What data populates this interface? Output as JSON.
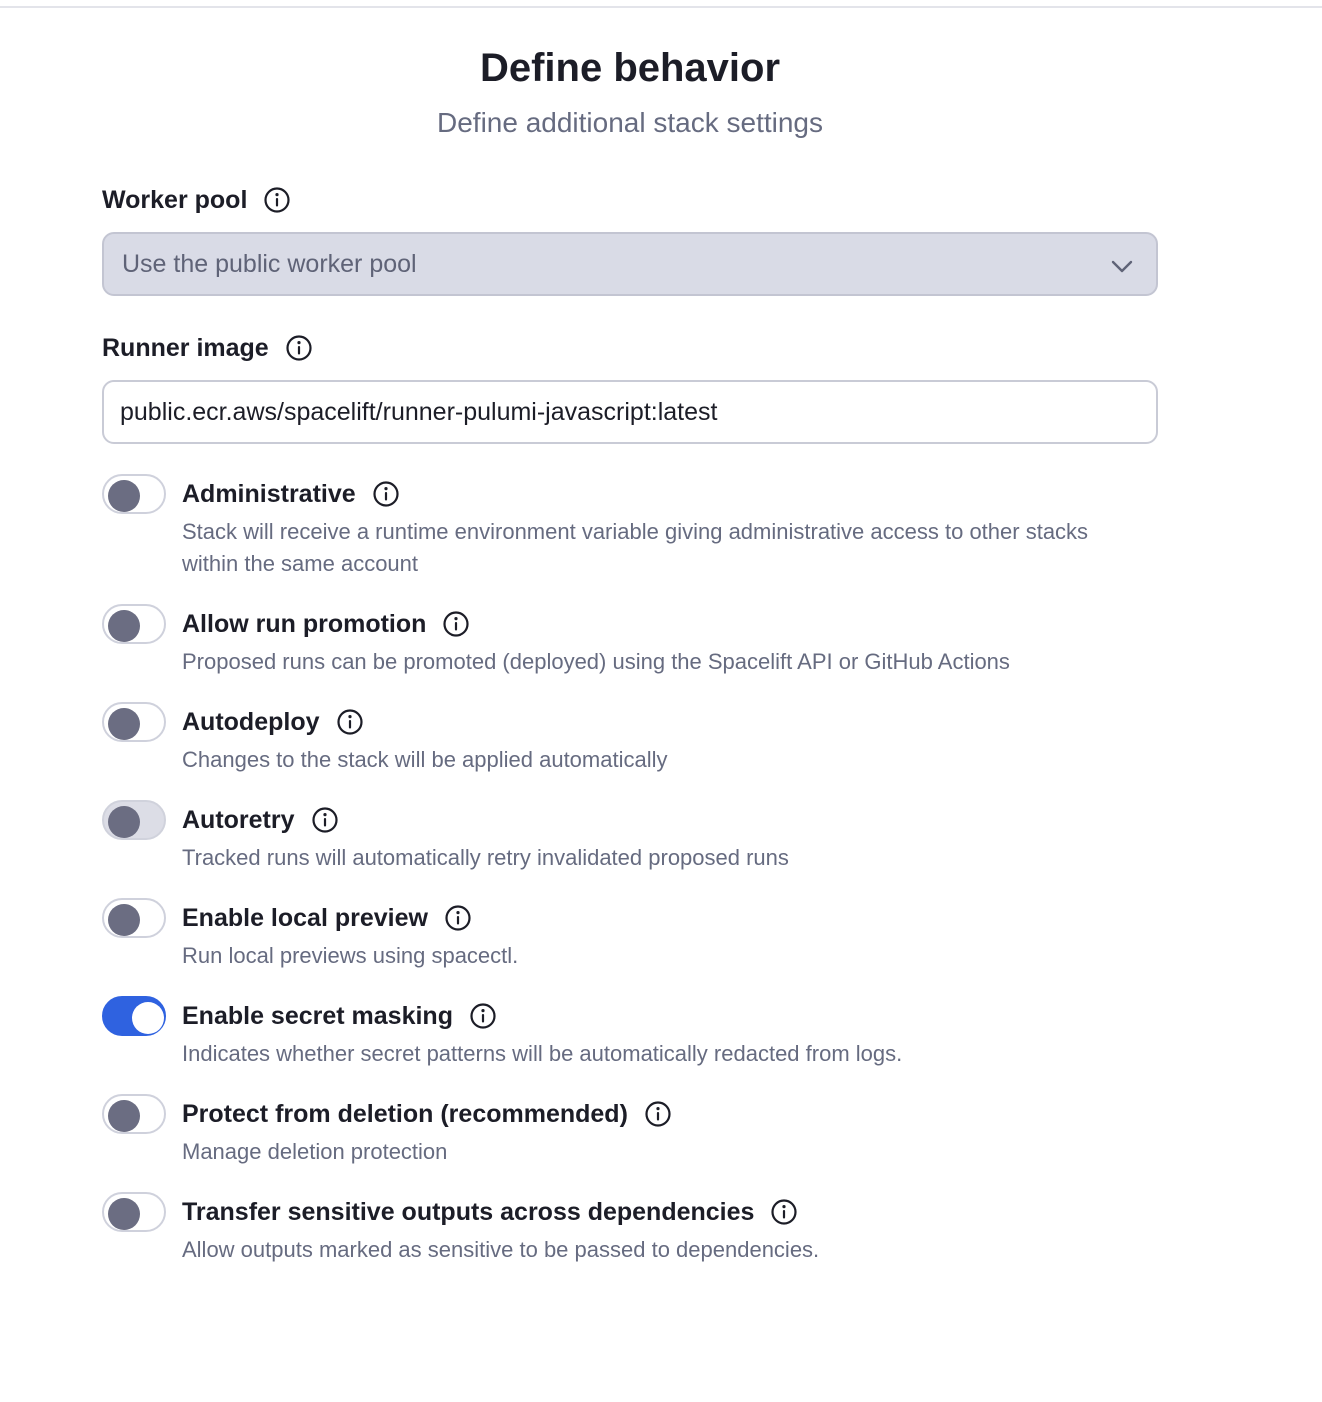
{
  "header": {
    "title": "Define behavior",
    "subtitle": "Define additional stack settings"
  },
  "worker_pool": {
    "label": "Worker pool",
    "value": "Use the public worker pool",
    "disabled": true
  },
  "runner_image": {
    "label": "Runner image",
    "value": "public.ecr.aws/spacelift/runner-pulumi-javascript:latest"
  },
  "toggles": [
    {
      "title": "Administrative",
      "description": "Stack will receive a runtime environment variable giving administrative access to other stacks within the same account",
      "on": false
    },
    {
      "title": "Allow run promotion",
      "description": "Proposed runs can be promoted (deployed) using the Spacelift API or GitHub Actions",
      "on": false
    },
    {
      "title": "Autodeploy",
      "description": "Changes to the stack will be applied automatically",
      "on": false
    },
    {
      "title": "Autoretry",
      "description": "Tracked runs will automatically retry invalidated proposed runs",
      "on": false,
      "disabled": true
    },
    {
      "title": "Enable local preview",
      "description": "Run local previews using spacectl.",
      "on": false
    },
    {
      "title": "Enable secret masking",
      "description": "Indicates whether secret patterns will be automatically redacted from logs.",
      "on": true
    },
    {
      "title": "Protect from deletion (recommended)",
      "description": "Manage deletion protection",
      "on": false
    },
    {
      "title": "Transfer sensitive outputs across dependencies",
      "description": "Allow outputs marked as sensitive to be passed to dependencies.",
      "on": false
    }
  ],
  "colors": {
    "accent": "#2f62e0",
    "knob_off": "#6b6d82",
    "muted_text": "#666b80"
  },
  "icons": {
    "info": "info-circle-icon",
    "chevron": "chevron-down-icon"
  }
}
